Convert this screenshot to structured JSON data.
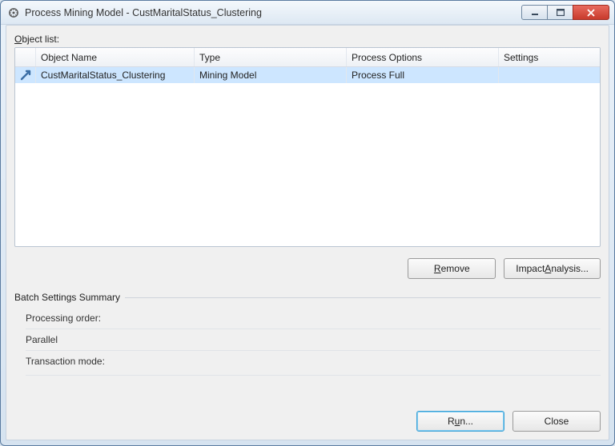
{
  "window": {
    "title": "Process Mining Model - CustMaritalStatus_Clustering"
  },
  "section": {
    "object_list_label_pre": "O",
    "object_list_label_post": "bject list:",
    "batch_settings_label": "Batch Settings Summary"
  },
  "table": {
    "headers": {
      "name": "Object Name",
      "type": "Type",
      "process_options": "Process Options",
      "settings": "Settings"
    },
    "rows": [
      {
        "name": "CustMaritalStatus_Clustering",
        "type": "Mining Model",
        "process_options": "Process Full",
        "settings": ""
      }
    ]
  },
  "buttons": {
    "remove_u": "R",
    "remove_rest": "emove",
    "impact_pre": "Impact ",
    "impact_u": "A",
    "impact_rest": "nalysis...",
    "run_pre": "R",
    "run_u": "u",
    "run_rest": "n...",
    "close": "Close"
  },
  "summary": {
    "processing_order_label": "Processing order:",
    "processing_order_value": "Parallel",
    "transaction_mode_label": "Transaction mode:"
  }
}
